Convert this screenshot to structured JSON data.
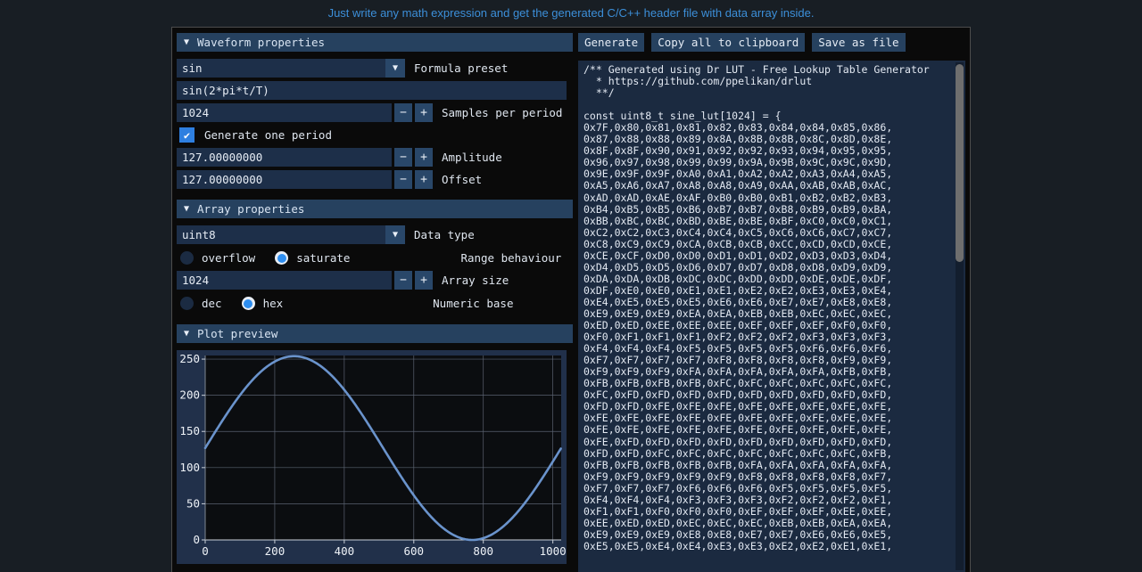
{
  "tagline": "Just write any math expression and get the generated C/C++ header file with data array inside.",
  "colors": {
    "page_bg": "#181e24",
    "window_bg": "#0a0a0a",
    "accent": "#3c8fd9",
    "section_header": "#26415f",
    "field_bg": "#1d2f49",
    "radio_on": "#2e8ef0",
    "plot_line": "#6a93cc"
  },
  "sections": {
    "waveform": {
      "title": "Waveform properties",
      "collapse_icon": "triangle-down-icon",
      "formula_preset": {
        "value": "sin",
        "label": "Formula preset",
        "icon": "chevron-down-icon"
      },
      "formula": {
        "value": "sin(2*pi*t/T)"
      },
      "samples_per_period": {
        "value": "1024",
        "label": "Samples per period",
        "minus": "−",
        "plus": "+"
      },
      "generate_one_period": {
        "label": "Generate one period",
        "checked": true,
        "check_glyph": "✔"
      },
      "amplitude": {
        "value": "127.00000000",
        "label": "Amplitude",
        "minus": "−",
        "plus": "+"
      },
      "offset": {
        "value": "127.00000000",
        "label": "Offset",
        "minus": "−",
        "plus": "+"
      }
    },
    "array": {
      "title": "Array properties",
      "collapse_icon": "triangle-down-icon",
      "data_type": {
        "value": "uint8",
        "label": "Data type",
        "icon": "chevron-down-icon"
      },
      "range_behaviour": {
        "label": "Range behaviour",
        "options": [
          "overflow",
          "saturate"
        ],
        "selected": "saturate"
      },
      "array_size": {
        "value": "1024",
        "label": "Array size",
        "minus": "−",
        "plus": "+"
      },
      "numeric_base": {
        "label": "Numeric base",
        "options": [
          "dec",
          "hex"
        ],
        "selected": "hex"
      }
    },
    "plot": {
      "title": "Plot preview",
      "collapse_icon": "triangle-down-icon"
    }
  },
  "toolbar": {
    "generate": "Generate",
    "copy_all": "Copy all to clipboard",
    "save_as_file": "Save as file"
  },
  "code": {
    "text": "/** Generated using Dr LUT - Free Lookup Table Generator\n  * https://github.com/ppelikan/drlut\n  **/\n\nconst uint8_t sine_lut[1024] = {\n0x7F,0x80,0x81,0x81,0x82,0x83,0x84,0x84,0x85,0x86,\n0x87,0x88,0x88,0x89,0x8A,0x8B,0x8B,0x8C,0x8D,0x8E,\n0x8F,0x8F,0x90,0x91,0x92,0x92,0x93,0x94,0x95,0x95,\n0x96,0x97,0x98,0x99,0x99,0x9A,0x9B,0x9C,0x9C,0x9D,\n0x9E,0x9F,0x9F,0xA0,0xA1,0xA2,0xA2,0xA3,0xA4,0xA5,\n0xA5,0xA6,0xA7,0xA8,0xA8,0xA9,0xAA,0xAB,0xAB,0xAC,\n0xAD,0xAD,0xAE,0xAF,0xB0,0xB0,0xB1,0xB2,0xB2,0xB3,\n0xB4,0xB5,0xB5,0xB6,0xB7,0xB7,0xB8,0xB9,0xB9,0xBA,\n0xBB,0xBC,0xBC,0xBD,0xBE,0xBE,0xBF,0xC0,0xC0,0xC1,\n0xC2,0xC2,0xC3,0xC4,0xC4,0xC5,0xC6,0xC6,0xC7,0xC7,\n0xC8,0xC9,0xC9,0xCA,0xCB,0xCB,0xCC,0xCD,0xCD,0xCE,\n0xCE,0xCF,0xD0,0xD0,0xD1,0xD1,0xD2,0xD3,0xD3,0xD4,\n0xD4,0xD5,0xD5,0xD6,0xD7,0xD7,0xD8,0xD8,0xD9,0xD9,\n0xDA,0xDA,0xDB,0xDC,0xDC,0xDD,0xDD,0xDE,0xDE,0xDF,\n0xDF,0xE0,0xE0,0xE1,0xE1,0xE2,0xE2,0xE3,0xE3,0xE4,\n0xE4,0xE5,0xE5,0xE5,0xE6,0xE6,0xE7,0xE7,0xE8,0xE8,\n0xE9,0xE9,0xE9,0xEA,0xEA,0xEB,0xEB,0xEC,0xEC,0xEC,\n0xED,0xED,0xEE,0xEE,0xEE,0xEF,0xEF,0xEF,0xF0,0xF0,\n0xF0,0xF1,0xF1,0xF1,0xF2,0xF2,0xF2,0xF3,0xF3,0xF3,\n0xF4,0xF4,0xF4,0xF5,0xF5,0xF5,0xF5,0xF6,0xF6,0xF6,\n0xF7,0xF7,0xF7,0xF7,0xF8,0xF8,0xF8,0xF8,0xF9,0xF9,\n0xF9,0xF9,0xF9,0xFA,0xFA,0xFA,0xFA,0xFA,0xFB,0xFB,\n0xFB,0xFB,0xFB,0xFB,0xFC,0xFC,0xFC,0xFC,0xFC,0xFC,\n0xFC,0xFD,0xFD,0xFD,0xFD,0xFD,0xFD,0xFD,0xFD,0xFD,\n0xFD,0xFD,0xFE,0xFE,0xFE,0xFE,0xFE,0xFE,0xFE,0xFE,\n0xFE,0xFE,0xFE,0xFE,0xFE,0xFE,0xFE,0xFE,0xFE,0xFE,\n0xFE,0xFE,0xFE,0xFE,0xFE,0xFE,0xFE,0xFE,0xFE,0xFE,\n0xFE,0xFD,0xFD,0xFD,0xFD,0xFD,0xFD,0xFD,0xFD,0xFD,\n0xFD,0xFD,0xFC,0xFC,0xFC,0xFC,0xFC,0xFC,0xFC,0xFB,\n0xFB,0xFB,0xFB,0xFB,0xFB,0xFA,0xFA,0xFA,0xFA,0xFA,\n0xF9,0xF9,0xF9,0xF9,0xF9,0xF8,0xF8,0xF8,0xF8,0xF7,\n0xF7,0xF7,0xF7,0xF6,0xF6,0xF6,0xF5,0xF5,0xF5,0xF5,\n0xF4,0xF4,0xF4,0xF3,0xF3,0xF3,0xF2,0xF2,0xF2,0xF1,\n0xF1,0xF1,0xF0,0xF0,0xF0,0xEF,0xEF,0xEF,0xEE,0xEE,\n0xEE,0xED,0xED,0xEC,0xEC,0xEC,0xEB,0xEB,0xEA,0xEA,\n0xE9,0xE9,0xE9,0xE8,0xE8,0xE7,0xE7,0xE6,0xE6,0xE5,\n0xE5,0xE5,0xE4,0xE4,0xE3,0xE3,0xE2,0xE2,0xE1,0xE1,"
  },
  "chart_data": {
    "type": "line",
    "title": "Plot preview",
    "xlabel": "",
    "ylabel": "",
    "xlim": [
      0,
      1024
    ],
    "ylim": [
      0,
      255
    ],
    "xticks": [
      0,
      200,
      400,
      600,
      800,
      1000
    ],
    "yticks": [
      0,
      50,
      100,
      150,
      200,
      250
    ],
    "grid": true,
    "series": [
      {
        "name": "sine_lut",
        "color": "#6a93cc",
        "formula": "127*sin(2*pi*t/1024)+127",
        "x": [
          0,
          32,
          64,
          96,
          128,
          160,
          192,
          224,
          256,
          288,
          320,
          352,
          384,
          416,
          448,
          480,
          512,
          544,
          576,
          608,
          640,
          672,
          704,
          736,
          768,
          800,
          832,
          864,
          896,
          928,
          960,
          992,
          1023
        ],
        "y": [
          127,
          151,
          175,
          197,
          217,
          234,
          246,
          253,
          254,
          253,
          246,
          234,
          217,
          197,
          175,
          151,
          127,
          103,
          79,
          57,
          37,
          20,
          8,
          1,
          0,
          1,
          8,
          20,
          37,
          57,
          79,
          101,
          126
        ]
      }
    ]
  }
}
